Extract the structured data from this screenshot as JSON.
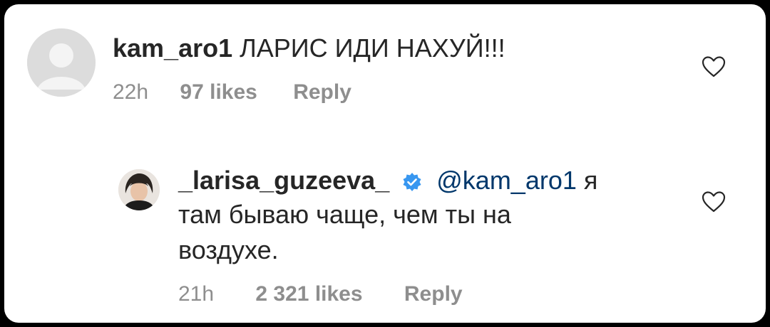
{
  "comment1": {
    "username": "kam_aro1",
    "text": "ЛАРИС ИДИ НАХУЙ!!!",
    "time": "22h",
    "likes": "97 likes",
    "reply": "Reply"
  },
  "comment2": {
    "username": "_larisa_guzeeva_",
    "mention": "@kam_aro1",
    "text_line1": "я",
    "text_line2": "там бываю чаще, чем ты на",
    "text_line3": "воздухе.",
    "time": "21h",
    "likes": "2 321 likes",
    "reply": "Reply"
  },
  "colors": {
    "mention": "#00376b",
    "verified": "#3897f0",
    "meta": "#8e8e8e"
  },
  "icons": {
    "heart": "heart-outline-icon",
    "verified": "verified-badge-icon",
    "avatar_default": "default-avatar-icon"
  }
}
